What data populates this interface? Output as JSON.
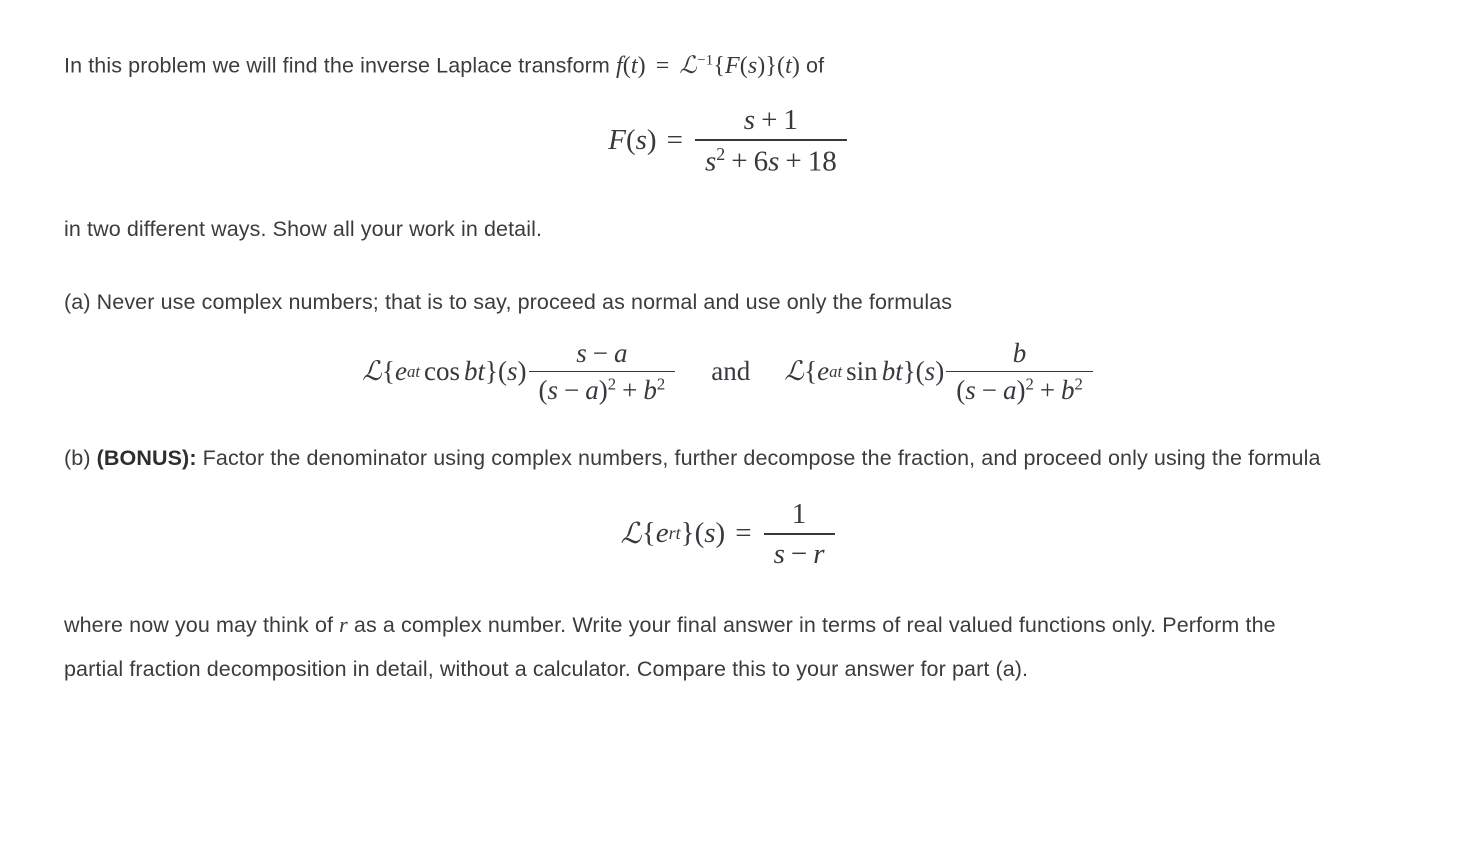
{
  "document": {
    "type": "math-problem",
    "topic": "Inverse Laplace transform",
    "text_color": "#3c3c3c",
    "math_color": "#36393d",
    "background": "#ffffff"
  },
  "paragraph1": {
    "lead": "In this problem we will find the inverse Laplace transform ",
    "inline_math": {
      "f": "f",
      "lparen1": "(",
      "t1": "t",
      "rparen1": ")",
      "equals": "=",
      "script_L": "ℒ",
      "exponent": "−1",
      "lbrace": "{",
      "F": "F",
      "lparen2": "(",
      "s": "s",
      "rparen2": ")",
      "rbrace": "}",
      "lparen3": "(",
      "t2": "t",
      "rparen3": ")"
    },
    "trail": " of"
  },
  "equation1": {
    "lhs": {
      "F": "F",
      "lparen": "(",
      "s": "s",
      "rparen": ")"
    },
    "equals": "=",
    "numerator": {
      "s": "s",
      "plus": "+",
      "one": "1"
    },
    "denominator": {
      "s": "s",
      "power": "2",
      "plus1": "+",
      "six": "6",
      "s2": "s",
      "plus2": "+",
      "eighteen": "18"
    }
  },
  "paragraph2": {
    "text": "in two different ways. Show all your work in detail."
  },
  "paragraph3": {
    "text": "(a) Never use complex numbers; that is to say, proceed as normal and use only the formulas"
  },
  "equation2": {
    "left_formula": {
      "script_L": "ℒ",
      "lbrace": "{",
      "e": "e",
      "exponent": "at",
      "func": "cos",
      "b": "b",
      "t": "t",
      "rbrace": "}",
      "lparen": "(",
      "s": "s",
      "rparen": ")",
      "numerator": {
        "s": "s",
        "minus": "−",
        "a": "a"
      },
      "denominator": {
        "lparen": "(",
        "s": "s",
        "minus": "−",
        "a": "a",
        "rparen": ")",
        "power": "2",
        "plus": "+",
        "b": "b",
        "bpower": "2"
      }
    },
    "conjunction": "and",
    "right_formula": {
      "script_L": "ℒ",
      "lbrace": "{",
      "e": "e",
      "exponent": "at",
      "func": "sin",
      "b": "b",
      "t": "t",
      "rbrace": "}",
      "lparen": "(",
      "s": "s",
      "rparen": ")",
      "numerator": {
        "b": "b"
      },
      "denominator": {
        "lparen": "(",
        "s": "s",
        "minus": "−",
        "a": "a",
        "rparen": ")",
        "power": "2",
        "plus": "+",
        "b": "b",
        "bpower": "2"
      }
    }
  },
  "paragraph4": {
    "prefix": "(b) ",
    "bold": "(BONUS):",
    "text": " Factor the denominator using complex numbers, further decompose the fraction, and proceed only using the formula"
  },
  "equation3": {
    "lhs": {
      "script_L": "ℒ",
      "lbrace": "{",
      "e": "e",
      "exponent": "rt",
      "rbrace": "}",
      "lparen": "(",
      "s": "s",
      "rparen": ")"
    },
    "equals": "=",
    "numerator": {
      "one": "1"
    },
    "denominator": {
      "s": "s",
      "minus": "−",
      "r": "r"
    }
  },
  "paragraph5": {
    "seg1": "where now you may think of ",
    "var_r": "r",
    "seg2": " as a complex number. Write your final answer in terms of real valued functions only. Perform the partial fraction decomposition in detail, without a calculator. Compare this to your answer for part (a)."
  }
}
